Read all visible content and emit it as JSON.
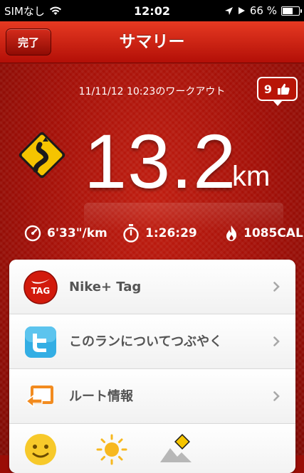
{
  "status_bar": {
    "carrier": "SIMなし",
    "time": "12:02",
    "battery_percent": "66 %",
    "battery_level": 0.66
  },
  "nav": {
    "done_label": "完了",
    "title": "サマリー"
  },
  "summary": {
    "workout_date": "11/11/12 10:23のワークアウト",
    "likes_count": "9",
    "distance_value": "13.2",
    "distance_unit": "km",
    "pace": "6'33\"/km",
    "duration": "1:26:29",
    "calories": "1085CAL"
  },
  "list": {
    "items": [
      {
        "label": "Nike+ Tag",
        "icon": "nike-tag-icon"
      },
      {
        "label": "このランについてつぶやく",
        "icon": "twitter-icon"
      },
      {
        "label": "ルート情報",
        "icon": "route-icon"
      }
    ]
  },
  "colors": {
    "nav_red": "#d8281a",
    "background_red": "#a10f07",
    "sign_yellow": "#f5c400",
    "twitter_blue": "#33aee4",
    "route_orange": "#f28b1f"
  }
}
